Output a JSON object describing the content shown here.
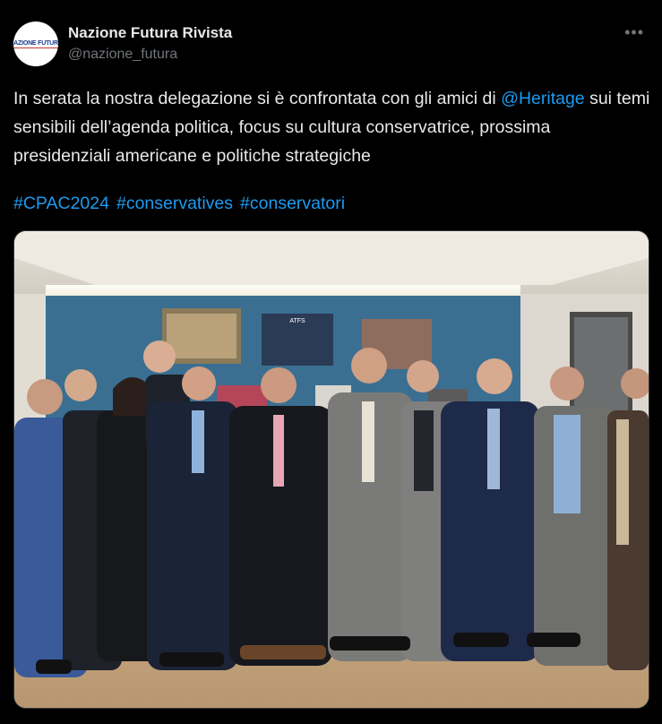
{
  "account": {
    "display_name": "Nazione Futura Rivista",
    "handle": "@nazione_futura",
    "avatar_text": "NAZIONE FUTURA"
  },
  "tweet": {
    "text_before": "In serata la nostra delegazione si è confrontata con gli amici di ",
    "mention": "@Heritage",
    "text_after": " sui temi sensibili dell’agenda politica, focus su cultura conservatrice, prossima presidenziali americane e politiche strategiche",
    "hashtags": [
      "#CPAC2024",
      "#conservatives",
      "#conservatori"
    ]
  },
  "photo": {
    "sign_text": "ATFS"
  },
  "icons": {
    "more": "more-options-icon"
  },
  "colors": {
    "background": "#000000",
    "text": "#e7e9ea",
    "muted": "#71767b",
    "link": "#1d9bf0"
  }
}
